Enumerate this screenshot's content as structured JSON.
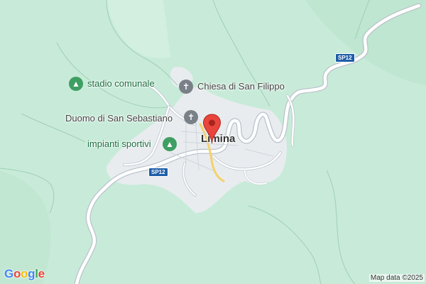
{
  "map": {
    "town_name": "Limina",
    "colors": {
      "terrain": "#c8ebd9",
      "urban": "#e9ecef",
      "road": "#ffffff",
      "road_outline": "#b9c2cb",
      "pin": "#e8453c"
    }
  },
  "pois": [
    {
      "label": "stadio comunale",
      "icon": "tree-icon",
      "kind": "park"
    },
    {
      "label": "Chiesa di San Filippo",
      "icon": "cross-icon",
      "kind": "place-of-worship"
    },
    {
      "label": "Duomo di San Sebastiano",
      "icon": "cross-icon",
      "kind": "place-of-worship"
    },
    {
      "label": "impianti sportivi",
      "icon": "tree-icon",
      "kind": "park"
    }
  ],
  "road_shields": [
    {
      "label": "SP12"
    },
    {
      "label": "SP12"
    }
  ],
  "attribution": "Map data ©2025",
  "logo": {
    "text": "Google",
    "letters": [
      {
        "ch": "G",
        "color": "#4285f4"
      },
      {
        "ch": "o",
        "color": "#ea4335"
      },
      {
        "ch": "o",
        "color": "#fbbc05"
      },
      {
        "ch": "g",
        "color": "#4285f4"
      },
      {
        "ch": "l",
        "color": "#34a853"
      },
      {
        "ch": "e",
        "color": "#ea4335"
      }
    ]
  }
}
